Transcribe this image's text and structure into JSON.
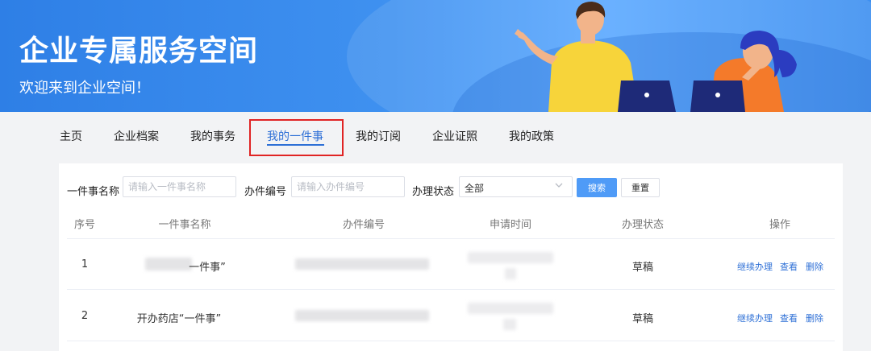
{
  "banner": {
    "title": "企业专属服务空间",
    "subtitle": "欢迎来到企业空间！"
  },
  "nav": {
    "items": [
      {
        "label": "主页"
      },
      {
        "label": "企业档案"
      },
      {
        "label": "我的事务"
      },
      {
        "label": "我的一件事",
        "active": true
      },
      {
        "label": "我的订阅"
      },
      {
        "label": "企业证照"
      },
      {
        "label": "我的政策"
      }
    ]
  },
  "filters": {
    "name_label": "一件事名称",
    "name_placeholder": "请输入一件事名称",
    "code_label": "办件编号",
    "code_placeholder": "请输入办件编号",
    "status_label": "办理状态",
    "status_value": "全部",
    "search_label": "搜索",
    "reset_label": "重置"
  },
  "table": {
    "headers": [
      "序号",
      "一件事名称",
      "办件编号",
      "申请时间",
      "办理状态",
      "操作"
    ],
    "rows": [
      {
        "index": "1",
        "name": "一件事”",
        "code": "",
        "time": "",
        "status": "草稿",
        "actions": [
          "继续办理",
          "查看",
          "删除"
        ]
      },
      {
        "index": "2",
        "name": "开办药店“一件事”",
        "code": "",
        "time": "",
        "status": "草稿",
        "actions": [
          "继续办理",
          "查看",
          "删除"
        ]
      }
    ]
  },
  "colors": {
    "accent": "#2d6fd6",
    "highlight_border": "#e02424",
    "banner": "#3f91f0",
    "search_button": "#4f9bf7"
  }
}
